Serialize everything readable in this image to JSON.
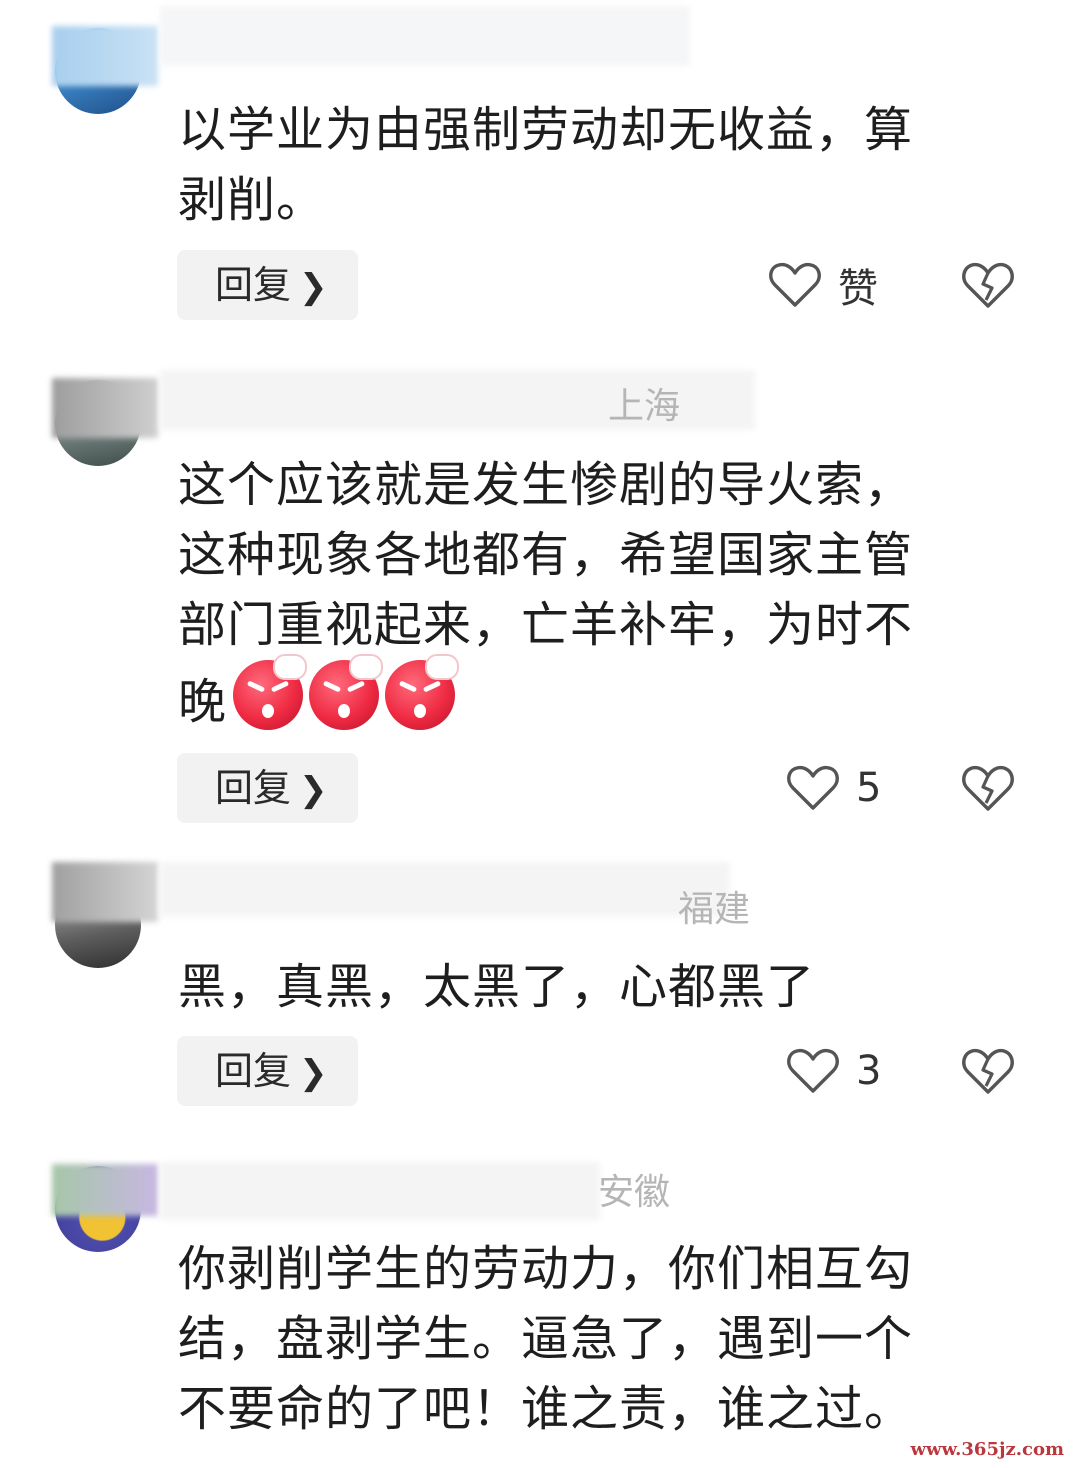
{
  "comments": [
    {
      "location": "",
      "text_lines": [
        "以学业为由强制劳动却无收益，算",
        "剥削。"
      ],
      "reply_label": "回复",
      "like_label": "赞"
    },
    {
      "location": "上海",
      "text_lines": [
        "这个应该就是发生惨剧的导火索，",
        "这种现象各地都有，希望国家主管",
        "部门重视起来，亡羊补牢，为时不",
        "晚"
      ],
      "reply_label": "回复",
      "like_label": "5"
    },
    {
      "location": "福建",
      "text_lines": [
        "黑，真黑，太黑了，心都黑了"
      ],
      "reply_label": "回复",
      "like_label": "3"
    },
    {
      "location": "安徽",
      "text_lines": [
        "你剥削学生的劳动力，你们相互勾",
        "结，盘剥学生。逼急了，遇到一个",
        "不要命的了吧！谁之责，谁之过。"
      ]
    }
  ],
  "icons": {
    "like": "heart-outline-icon",
    "dislike": "broken-heart-icon",
    "reply_chevron": "chevron-right-icon",
    "emoji": "angry-face-emoji"
  },
  "colors": {
    "text": "#1e1e1e",
    "meta": "#b5b5b5",
    "button_bg": "#f2f2f2",
    "emoji_red": "#ef2b43"
  },
  "watermark": "www.365jz.com"
}
